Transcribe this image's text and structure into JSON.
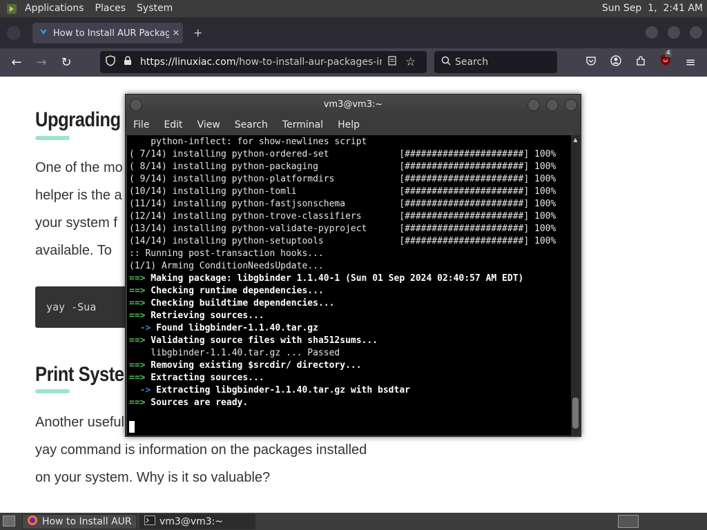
{
  "top_panel": {
    "menus": [
      "Applications",
      "Places",
      "System"
    ],
    "clock": "Sun Sep  1,  2:41 AM"
  },
  "browser": {
    "tab_title": "How to Install AUR Package",
    "url_domain": "https://linuxiac.com",
    "url_path": "/how-to-install-aur-packages-in-arc",
    "search_placeholder": "Search",
    "ublock_count": "4"
  },
  "page": {
    "heading1": "Upgrading A",
    "para1": [
      "One of the mo",
      "helper is the a",
      "your system f",
      "available. To"
    ],
    "code": "yay -Sua",
    "heading2": "Print System",
    "para2": [
      "Another useful",
      "yay command is information on the packages installed",
      "on your system. Why is it so valuable?"
    ]
  },
  "terminal": {
    "title": "vm3@vm3:~",
    "menu": [
      "File",
      "Edit",
      "View",
      "Search",
      "Terminal",
      "Help"
    ],
    "lines": [
      {
        "t": "    python-inflect: for show-newlines script",
        "s": ""
      },
      {
        "t": "( 7/14) installing python-ordered-set             [######################] 100%",
        "s": ""
      },
      {
        "t": "( 8/14) installing python-packaging               [######################] 100%",
        "s": ""
      },
      {
        "t": "( 9/14) installing python-platformdirs            [######################] 100%",
        "s": ""
      },
      {
        "t": "(10/14) installing python-tomli                   [######################] 100%",
        "s": ""
      },
      {
        "t": "(11/14) installing python-fastjsonschema          [######################] 100%",
        "s": ""
      },
      {
        "t": "(12/14) installing python-trove-classifiers       [######################] 100%",
        "s": ""
      },
      {
        "t": "(13/14) installing python-validate-pyproject      [######################] 100%",
        "s": ""
      },
      {
        "t": "(14/14) installing python-setuptools              [######################] 100%",
        "s": ""
      },
      {
        "t": ":: Running post-transaction hooks...",
        "s": ""
      },
      {
        "t": "(1/1) Arming ConditionNeedsUpdate...",
        "s": ""
      },
      {
        "p": "==>",
        "t": " Making package: libgbinder 1.1.40-1 (Sun 01 Sep 2024 02:40:57 AM EDT)",
        "s": "green"
      },
      {
        "p": "==>",
        "t": " Checking runtime dependencies...",
        "s": "green"
      },
      {
        "p": "==>",
        "t": " Checking buildtime dependencies...",
        "s": "green"
      },
      {
        "p": "==>",
        "t": " Retrieving sources...",
        "s": "green"
      },
      {
        "p": "  ->",
        "t": " Found libgbinder-1.1.40.tar.gz",
        "s": "blue"
      },
      {
        "p": "==>",
        "t": " Validating source files with sha512sums...",
        "s": "green"
      },
      {
        "t": "    libgbinder-1.1.40.tar.gz ... Passed",
        "s": ""
      },
      {
        "p": "==>",
        "t": " Removing existing $srcdir/ directory...",
        "s": "green"
      },
      {
        "p": "==>",
        "t": " Extracting sources...",
        "s": "green"
      },
      {
        "p": "  ->",
        "t": " Extracting libgbinder-1.1.40.tar.gz with bsdtar",
        "s": "blue"
      },
      {
        "p": "==>",
        "t": " Sources are ready.",
        "s": "green"
      }
    ]
  },
  "taskbar": {
    "firefox_task": "How to Install AUR ...",
    "terminal_task": "vm3@vm3:~"
  },
  "colors": {
    "arrow_green": "#4fc14f",
    "arrow_blue": "#3f7fdd",
    "heading_underline": "#9de3d1"
  }
}
